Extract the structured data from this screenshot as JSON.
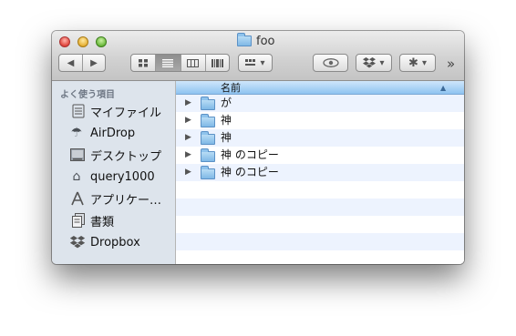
{
  "window": {
    "title": "foo"
  },
  "toolbar": {
    "back_glyph": "◀",
    "forward_glyph": "▶",
    "view_icons": [
      "icon-view",
      "list-view",
      "column-view",
      "coverflow-view"
    ],
    "arrange_icon": "arrange-icon",
    "quicklook_icon": "eye-icon",
    "dropbox_icon": "dropbox-icon",
    "action_icon": "gear-icon",
    "overflow_glyph": "»"
  },
  "sidebar": {
    "heading": "よく使う項目",
    "items": [
      {
        "label": "マイファイル",
        "icon": "all-my-files-icon"
      },
      {
        "label": "AirDrop",
        "icon": "airdrop-icon"
      },
      {
        "label": "デスクトップ",
        "icon": "desktop-icon"
      },
      {
        "label": "query1000",
        "icon": "home-icon"
      },
      {
        "label": "アプリケー…",
        "icon": "applications-icon"
      },
      {
        "label": "書類",
        "icon": "documents-icon"
      },
      {
        "label": "Dropbox",
        "icon": "dropbox-icon"
      }
    ]
  },
  "list": {
    "column_name": "名前",
    "sort_indicator": "▲",
    "files": [
      {
        "name": "が",
        "type": "folder"
      },
      {
        "name": "神",
        "type": "folder"
      },
      {
        "name": "神",
        "type": "folder"
      },
      {
        "name": "神 のコピー",
        "type": "folder"
      },
      {
        "name": "神 のコピー",
        "type": "folder"
      }
    ]
  },
  "colors": {
    "selection_header": "#8ec3f0",
    "sidebar_bg": "#dde4ec",
    "row_stripe": "#edf3fe"
  }
}
